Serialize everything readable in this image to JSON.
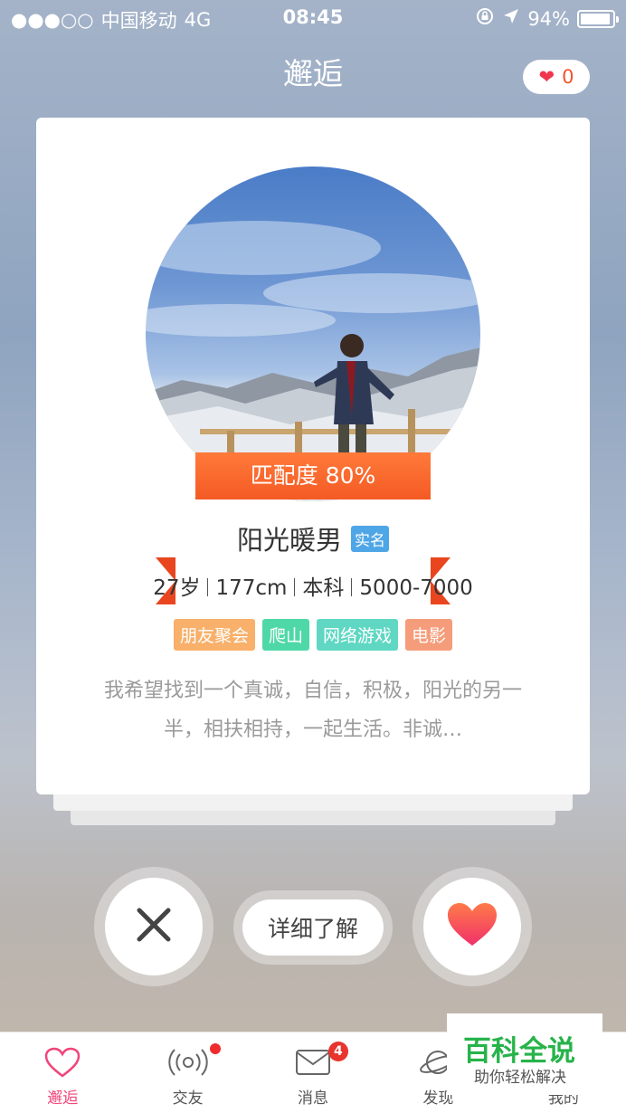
{
  "status_bar": {
    "signal": "●●●○○",
    "carrier": "中国移动",
    "network": "4G",
    "time": "08:45",
    "battery": "94%",
    "battery_level": 0.94
  },
  "header": {
    "title": "邂逅",
    "like_count": "0"
  },
  "card": {
    "match_label": "匹配度 80%",
    "name": "阳光暖男",
    "verify_badge": "实名",
    "age": "27岁",
    "height": "177cm",
    "education": "本科",
    "income": "5000-7000",
    "tags": [
      {
        "label": "朋友聚会",
        "color": "#f8b06a"
      },
      {
        "label": "爬山",
        "color": "#4fd8a7"
      },
      {
        "label": "网络游戏",
        "color": "#5fd7c3"
      },
      {
        "label": "电影",
        "color": "#f59c7a"
      }
    ],
    "bio": "我希望找到一个真诚，自信，积极，阳光的另一半，相扶相持，一起生活。非诚…"
  },
  "actions": {
    "detail_label": "详细了解"
  },
  "tabbar": {
    "items": [
      {
        "label": "邂逅",
        "icon": "heart-outline-icon",
        "active": true
      },
      {
        "label": "交友",
        "icon": "radar-icon"
      },
      {
        "label": "消息",
        "icon": "mail-icon",
        "badge": "4"
      },
      {
        "label": "发现",
        "icon": "planet-icon"
      },
      {
        "label": "我的",
        "icon": "user-icon"
      }
    ]
  },
  "watermark": {
    "title": "百科全说",
    "subtitle": "助你轻松解决"
  },
  "colors": {
    "accent": "#f0457a",
    "ribbon": "#f45a24",
    "heart": "#f0364f",
    "verify": "#4fa6e6"
  }
}
